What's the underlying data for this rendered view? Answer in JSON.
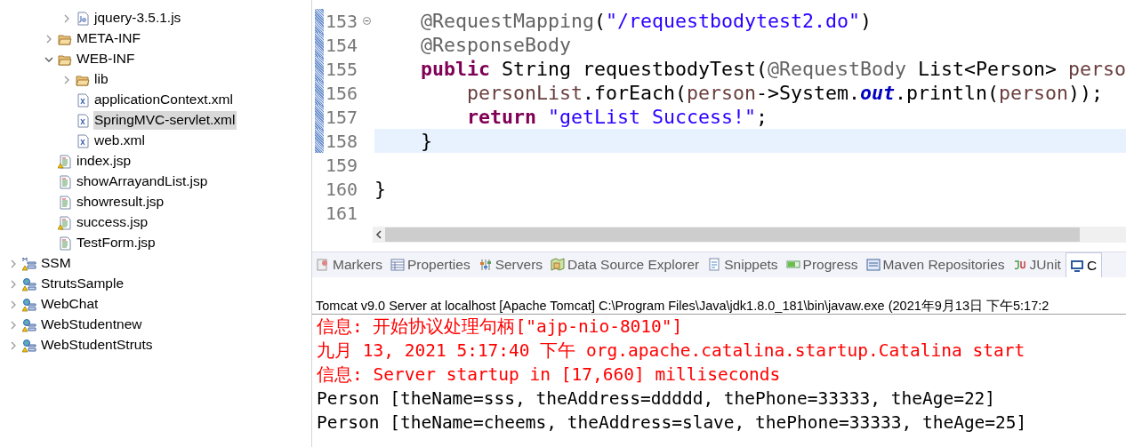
{
  "tree": {
    "items": [
      {
        "children": [
          {
            "children": [
              {
                "children": [
                  {
                    "label": "jquery-3.5.1.js",
                    "kind": "js",
                    "expanded": false,
                    "selected": false
                  }
                ]
              },
              {
                "label": "META-INF",
                "kind": "folder",
                "expanded": false,
                "selected": false
              },
              {
                "label": "WEB-INF",
                "kind": "folder",
                "expanded": true,
                "selected": false,
                "children": [
                  {
                    "label": "lib",
                    "kind": "folder",
                    "expanded": false,
                    "selected": false
                  },
                  {
                    "label": "applicationContext.xml",
                    "kind": "xml",
                    "selected": false
                  },
                  {
                    "label": "SpringMVC-servlet.xml",
                    "kind": "xml",
                    "selected": true
                  },
                  {
                    "label": "web.xml",
                    "kind": "xml",
                    "selected": false
                  }
                ]
              },
              {
                "label": "index.jsp",
                "kind": "jsp-warning",
                "selected": false
              },
              {
                "label": "showArrayandList.jsp",
                "kind": "jsp",
                "selected": false
              },
              {
                "label": "showresult.jsp",
                "kind": "jsp",
                "selected": false
              },
              {
                "label": "success.jsp",
                "kind": "jsp-warning",
                "selected": false
              },
              {
                "label": "TestForm.jsp",
                "kind": "jsp",
                "selected": false
              }
            ]
          }
        ]
      },
      {
        "label": "SSM",
        "kind": "maven-project",
        "expanded": false,
        "selected": false
      },
      {
        "label": "StrutsSample",
        "kind": "web-project",
        "expanded": false,
        "selected": false
      },
      {
        "label": "WebChat",
        "kind": "web-project",
        "expanded": false,
        "selected": false
      },
      {
        "label": "WebStudentnew",
        "kind": "web-project",
        "expanded": false,
        "selected": false
      },
      {
        "label": "WebStudentStruts",
        "kind": "web-project",
        "expanded": false,
        "selected": false
      }
    ]
  },
  "editor": {
    "lines": [
      {
        "number": "153",
        "changed": true,
        "current": false,
        "folded": false,
        "tokens": [
          {
            "kind": "annotation",
            "text": "    @RequestMapping"
          },
          {
            "kind": "plain",
            "text": "("
          },
          {
            "kind": "string",
            "text": "\"/requestbodytest2.do\""
          },
          {
            "kind": "plain",
            "text": ")"
          }
        ]
      },
      {
        "number": "154",
        "changed": true,
        "current": false,
        "tokens": [
          {
            "kind": "annotation",
            "text": "    @ResponseBody"
          }
        ]
      },
      {
        "number": "155",
        "changed": true,
        "current": false,
        "tokens": [
          {
            "kind": "keyword",
            "text": "    public"
          },
          {
            "kind": "plain",
            "text": " String requestbodyTest("
          },
          {
            "kind": "annotation",
            "text": "@RequestBody"
          },
          {
            "kind": "plain",
            "text": " List<Person> "
          },
          {
            "kind": "variable",
            "text": "perso"
          }
        ]
      },
      {
        "number": "156",
        "changed": true,
        "current": false,
        "tokens": [
          {
            "kind": "variable",
            "text": "        personList"
          },
          {
            "kind": "plain",
            "text": ".forEach("
          },
          {
            "kind": "variable",
            "text": "person"
          },
          {
            "kind": "plain",
            "text": "->System."
          },
          {
            "kind": "static",
            "text": "out"
          },
          {
            "kind": "plain",
            "text": ".println("
          },
          {
            "kind": "variable",
            "text": "person"
          },
          {
            "kind": "plain",
            "text": "));"
          }
        ]
      },
      {
        "number": "157",
        "changed": true,
        "current": false,
        "tokens": [
          {
            "kind": "keyword",
            "text": "        return"
          },
          {
            "kind": "string",
            "text": " \"getList Success!\""
          },
          {
            "kind": "plain",
            "text": ";"
          }
        ]
      },
      {
        "number": "158",
        "changed": true,
        "current": true,
        "tokens": [
          {
            "kind": "plain",
            "text": "    }"
          }
        ]
      },
      {
        "number": "159",
        "changed": false,
        "current": false
      },
      {
        "number": "160",
        "changed": false,
        "current": false,
        "tokens": [
          {
            "kind": "plain",
            "text": "}"
          }
        ]
      },
      {
        "number": "161",
        "changed": false,
        "current": false
      }
    ]
  },
  "panel": {
    "tabs": [
      {
        "label": "Markers",
        "kind": "markers",
        "selected": false
      },
      {
        "label": "Properties",
        "kind": "properties",
        "selected": false
      },
      {
        "label": "Servers",
        "kind": "servers",
        "selected": false
      },
      {
        "label": "Data Source Explorer",
        "kind": "datasource",
        "selected": false
      },
      {
        "label": "Snippets",
        "kind": "snippets",
        "selected": false
      },
      {
        "label": "Progress",
        "kind": "progress",
        "selected": false
      },
      {
        "label": "Maven Repositories",
        "kind": "maven",
        "selected": false
      },
      {
        "label": "JUnit",
        "kind": "junit",
        "selected": false
      },
      {
        "label": "C",
        "kind": "console",
        "selected": true
      }
    ]
  },
  "console": {
    "title": "Tomcat v9.0 Server at localhost [Apache Tomcat] C:\\Program Files\\Java\\jdk1.8.0_181\\bin\\javaw.exe (2021年9月13日 下午5:17:2",
    "lines": [
      {
        "text": "信息: 开始协议处理句柄[\"ajp-nio-8010\"]",
        "color": "#ff0000"
      },
      {
        "text": "九月 13, 2021 5:17:40 下午 org.apache.catalina.startup.Catalina start",
        "color": "#ff0000"
      },
      {
        "text": "信息: Server startup in [17,660] milliseconds",
        "color": "#ff0000"
      },
      {
        "text": "Person [theName=sss, theAddress=ddddd, thePhone=33333, theAge=22]",
        "color": "#000000"
      },
      {
        "text": "Person [theName=cheems, theAddress=slave, thePhone=33333, theAge=25]",
        "color": "#000000"
      }
    ]
  }
}
